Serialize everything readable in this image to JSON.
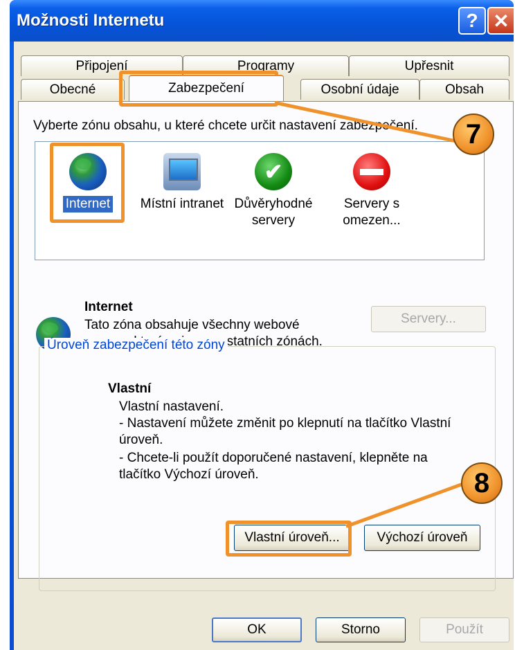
{
  "window": {
    "title": "Možnosti Internetu"
  },
  "tabs_top": [
    "Připojení",
    "Programy",
    "Upřesnit"
  ],
  "tabs_bottom": [
    "Obecné",
    "Zabezpečení",
    "Osobní údaje",
    "Obsah"
  ],
  "instruction": "Vyberte zónu obsahu, u které chcete určit nastavení zabezpečení.",
  "zones": [
    {
      "label": "Internet",
      "icon": "globe-icon"
    },
    {
      "label": "Místní intranet",
      "icon": "intranet-icon"
    },
    {
      "label": "Důvěryhodné servery",
      "icon": "trusted-check-icon"
    },
    {
      "label": "Servery s omezen...",
      "icon": "restricted-stop-icon"
    }
  ],
  "zone_info": {
    "name": "Internet",
    "description_line1": "Tato zóna obsahuje všechny webové",
    "description_line2": "servery, které nejsou v ostatních zónách.",
    "servers_button": "Servery..."
  },
  "security_level": {
    "legend": "Úroveň zabezpečení této zóny",
    "name": "Vlastní",
    "lines": [
      "Vlastní nastavení.",
      "- Nastavení můžete změnit po klepnutí na tlačítko Vlastní",
      "úroveň.",
      "- Chcete-li použít doporučené nastavení, klepněte na",
      "tlačítko Výchozí úroveň."
    ],
    "custom_button": "Vlastní úroveň...",
    "default_button": "Výchozí úroveň"
  },
  "footer": {
    "ok": "OK",
    "cancel": "Storno",
    "apply": "Použít"
  },
  "callouts": {
    "step7": "7",
    "step8": "8"
  },
  "colors": {
    "callout": "#f0922c",
    "selection": "#316ac5"
  }
}
